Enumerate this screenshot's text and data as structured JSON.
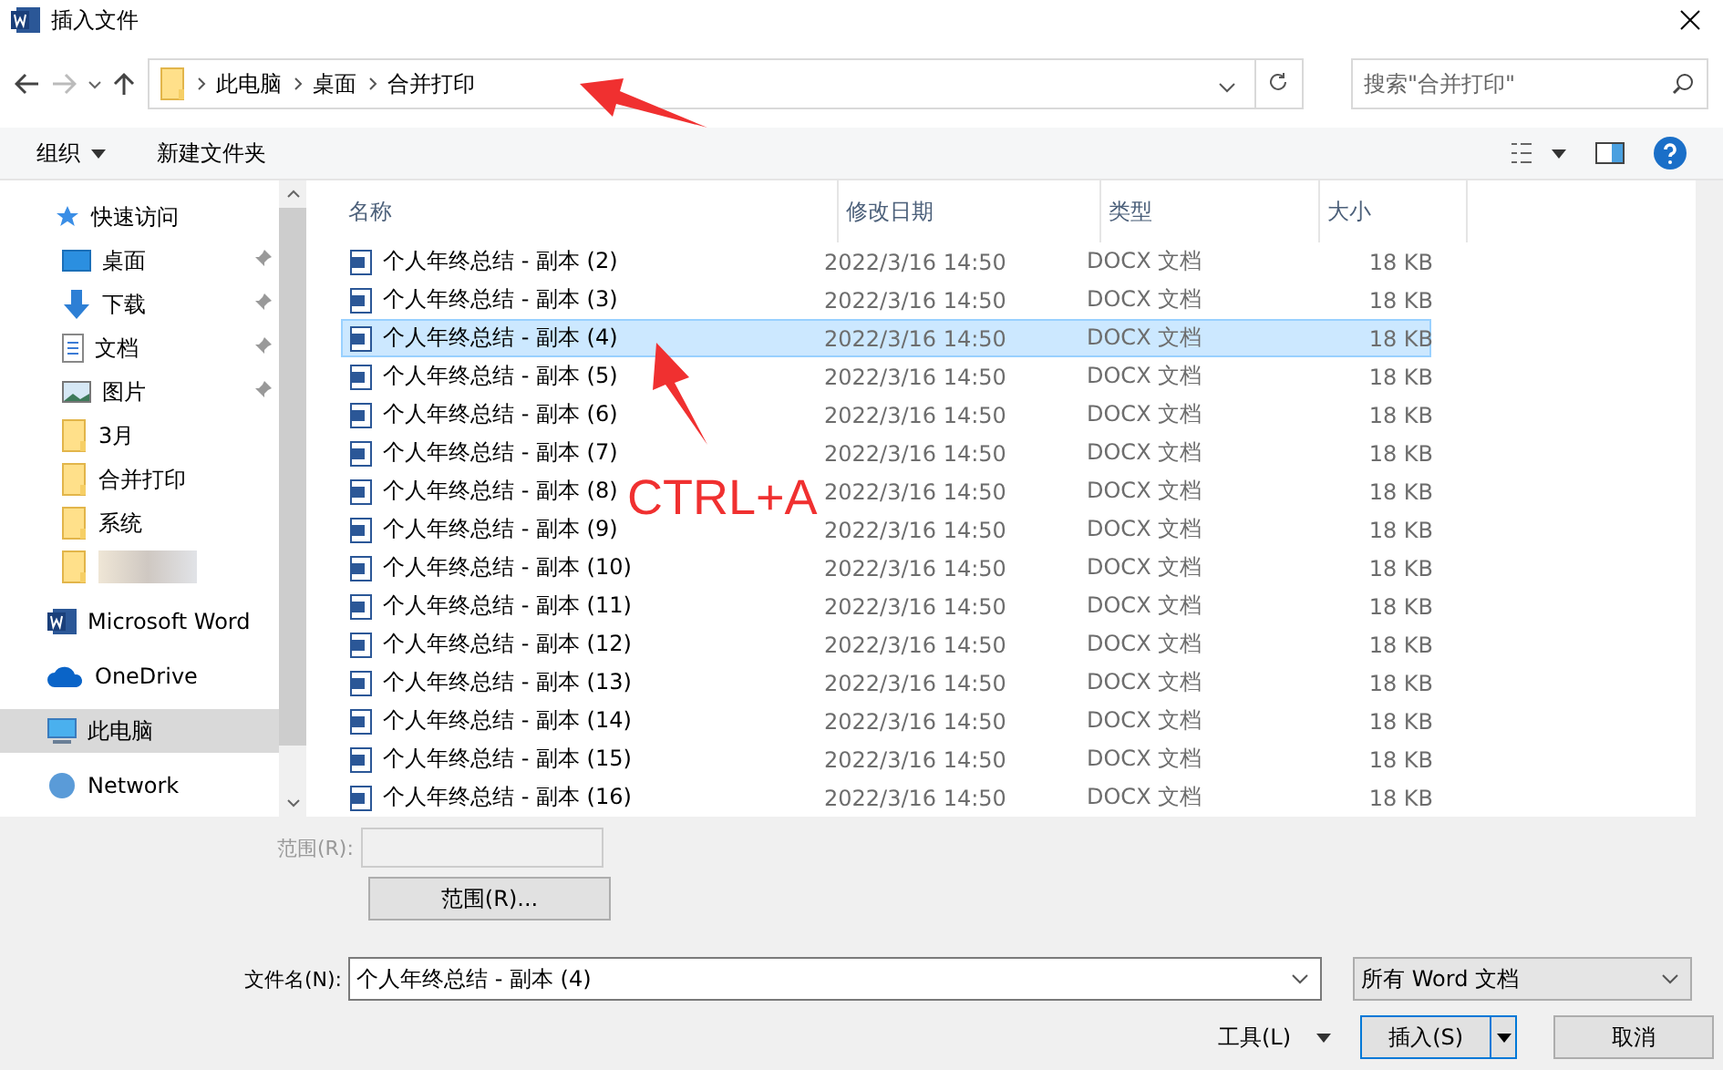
{
  "window": {
    "title": "插入文件"
  },
  "breadcrumb": [
    "此电脑",
    "桌面",
    "合并打印"
  ],
  "search": {
    "placeholder": "搜索\"合并打印\""
  },
  "toolbar": {
    "organize": "组织",
    "new_folder": "新建文件夹"
  },
  "sidebar": {
    "items": [
      {
        "label": "快速访问",
        "kind": "star",
        "pinned": false,
        "selected": false
      },
      {
        "label": "桌面",
        "kind": "desktop",
        "pinned": true,
        "selected": false
      },
      {
        "label": "下载",
        "kind": "download",
        "pinned": true,
        "selected": false
      },
      {
        "label": "文档",
        "kind": "document",
        "pinned": true,
        "selected": false
      },
      {
        "label": "图片",
        "kind": "picture",
        "pinned": true,
        "selected": false
      },
      {
        "label": "3月",
        "kind": "folder",
        "pinned": false,
        "selected": false
      },
      {
        "label": "合并打印",
        "kind": "folder",
        "pinned": false,
        "selected": false
      },
      {
        "label": "系统",
        "kind": "folder",
        "pinned": false,
        "selected": false
      },
      {
        "kind": "redacted",
        "pinned": false,
        "selected": false
      },
      {
        "label": "Microsoft Word",
        "kind": "word",
        "pinned": false,
        "selected": false
      },
      {
        "label": "OneDrive",
        "kind": "cloud",
        "pinned": false,
        "selected": false
      },
      {
        "label": "此电脑",
        "kind": "computer",
        "pinned": false,
        "selected": true
      },
      {
        "label": "Network",
        "kind": "network",
        "pinned": false,
        "selected": false
      }
    ]
  },
  "table": {
    "columns": [
      "名称",
      "修改日期",
      "类型",
      "大小"
    ],
    "rows": [
      {
        "name": "个人年终总结 - 副本 (2)",
        "date": "2022/3/16 14:50",
        "type": "DOCX 文档",
        "size": "18 KB",
        "selected": false
      },
      {
        "name": "个人年终总结 - 副本 (3)",
        "date": "2022/3/16 14:50",
        "type": "DOCX 文档",
        "size": "18 KB",
        "selected": false
      },
      {
        "name": "个人年终总结 - 副本 (4)",
        "date": "2022/3/16 14:50",
        "type": "DOCX 文档",
        "size": "18 KB",
        "selected": true
      },
      {
        "name": "个人年终总结 - 副本 (5)",
        "date": "2022/3/16 14:50",
        "type": "DOCX 文档",
        "size": "18 KB",
        "selected": false
      },
      {
        "name": "个人年终总结 - 副本 (6)",
        "date": "2022/3/16 14:50",
        "type": "DOCX 文档",
        "size": "18 KB",
        "selected": false
      },
      {
        "name": "个人年终总结 - 副本 (7)",
        "date": "2022/3/16 14:50",
        "type": "DOCX 文档",
        "size": "18 KB",
        "selected": false
      },
      {
        "name": "个人年终总结 - 副本 (8)",
        "date": "2022/3/16 14:50",
        "type": "DOCX 文档",
        "size": "18 KB",
        "selected": false
      },
      {
        "name": "个人年终总结 - 副本 (9)",
        "date": "2022/3/16 14:50",
        "type": "DOCX 文档",
        "size": "18 KB",
        "selected": false
      },
      {
        "name": "个人年终总结 - 副本 (10)",
        "date": "2022/3/16 14:50",
        "type": "DOCX 文档",
        "size": "18 KB",
        "selected": false
      },
      {
        "name": "个人年终总结 - 副本 (11)",
        "date": "2022/3/16 14:50",
        "type": "DOCX 文档",
        "size": "18 KB",
        "selected": false
      },
      {
        "name": "个人年终总结 - 副本 (12)",
        "date": "2022/3/16 14:50",
        "type": "DOCX 文档",
        "size": "18 KB",
        "selected": false
      },
      {
        "name": "个人年终总结 - 副本 (13)",
        "date": "2022/3/16 14:50",
        "type": "DOCX 文档",
        "size": "18 KB",
        "selected": false
      },
      {
        "name": "个人年终总结 - 副本 (14)",
        "date": "2022/3/16 14:50",
        "type": "DOCX 文档",
        "size": "18 KB",
        "selected": false
      },
      {
        "name": "个人年终总结 - 副本 (15)",
        "date": "2022/3/16 14:50",
        "type": "DOCX 文档",
        "size": "18 KB",
        "selected": false
      },
      {
        "name": "个人年终总结 - 副本 (16)",
        "date": "2022/3/16 14:50",
        "type": "DOCX 文档",
        "size": "18 KB",
        "selected": false
      }
    ]
  },
  "range": {
    "label": "范围(R):",
    "button": "范围(R)..."
  },
  "filename": {
    "label": "文件名(N):",
    "value": "个人年终总结 - 副本 (4)"
  },
  "filetype": {
    "value": "所有 Word 文档"
  },
  "buttons": {
    "tools": "工具(L)",
    "insert": "插入(S)",
    "cancel": "取消"
  },
  "annotation": {
    "text": "CTRL+A"
  }
}
